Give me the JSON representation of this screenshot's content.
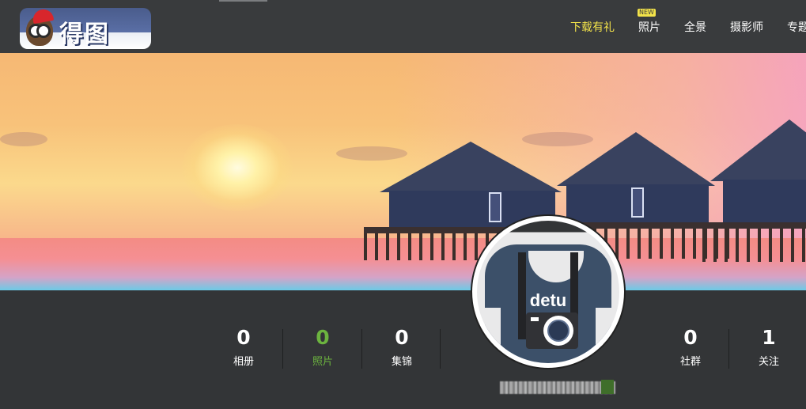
{
  "header": {
    "logo_text": "得图",
    "nav": [
      {
        "label": "下载有礼",
        "active": true
      },
      {
        "label": "照片",
        "active": false
      },
      {
        "label": "全景",
        "active": false
      },
      {
        "label": "摄影师",
        "active": false
      },
      {
        "label": "专题",
        "active": false
      }
    ],
    "new_badge": "NEW"
  },
  "avatar": {
    "brand_text": "detu"
  },
  "stats_left": [
    {
      "value": "0",
      "label": "相册",
      "highlight": false
    },
    {
      "value": "0",
      "label": "照片",
      "highlight": true
    },
    {
      "value": "0",
      "label": "集锦",
      "highlight": false
    }
  ],
  "stats_right": [
    {
      "value": "0",
      "label": "社群",
      "highlight": false
    },
    {
      "value": "1",
      "label": "关注",
      "highlight": false
    }
  ],
  "colors": {
    "header_bg": "#393b3d",
    "page_bg": "#333537",
    "active_nav": "#f3e34a",
    "highlight_stat": "#6cb43f"
  }
}
